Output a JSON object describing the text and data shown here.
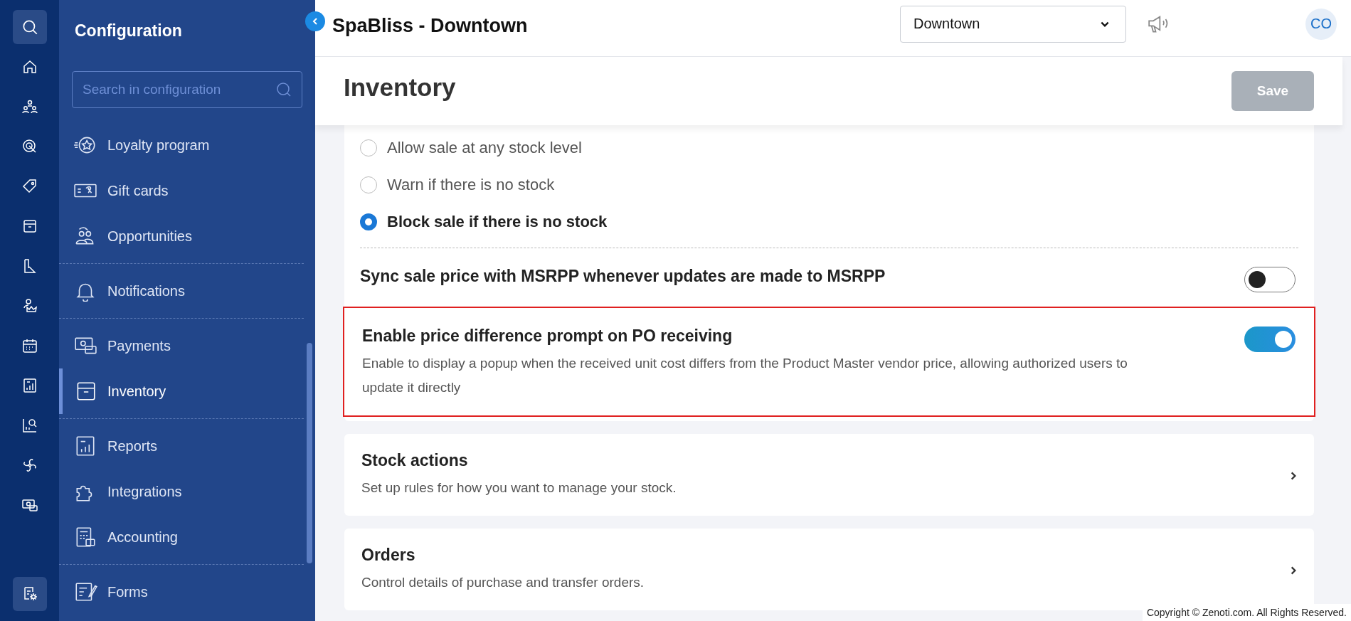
{
  "sidebar": {
    "title": "Configuration",
    "search": {
      "placeholder": "Search in configuration"
    },
    "groups": [
      [
        {
          "label": "Loyalty program",
          "selected": false
        },
        {
          "label": "Gift cards",
          "selected": false
        },
        {
          "label": "Opportunities",
          "selected": false
        }
      ],
      [
        {
          "label": "Notifications",
          "selected": false
        }
      ],
      [
        {
          "label": "Payments",
          "selected": false
        },
        {
          "label": "Inventory",
          "selected": true
        }
      ],
      [
        {
          "label": "Reports",
          "selected": false
        },
        {
          "label": "Integrations",
          "selected": false
        },
        {
          "label": "Accounting",
          "selected": false
        }
      ],
      [
        {
          "label": "Forms",
          "selected": false
        }
      ]
    ]
  },
  "header": {
    "title": "SpaBliss - Downtown",
    "location": "Downtown",
    "avatar": "CO"
  },
  "page": {
    "title": "Inventory",
    "save": {
      "label": "Save",
      "disabled": true
    }
  },
  "stock_options": [
    {
      "label": "Allow sale at any stock level",
      "selected": false
    },
    {
      "label": "Warn if there is no stock",
      "selected": false
    },
    {
      "label": "Block sale if there is no stock",
      "selected": true
    }
  ],
  "settings": [
    {
      "title": "Sync sale price with MSRPP whenever updates are made to MSRPP",
      "on": false,
      "highlighted": false
    },
    {
      "title": "Enable price difference prompt on PO receiving",
      "description": "Enable to display a popup when the received unit cost differs from the Product Master vendor price, allowing authorized users to update it directly",
      "on": true,
      "highlighted": true
    }
  ],
  "sections": [
    {
      "title": "Stock actions",
      "description": "Set up rules for how you want to manage your stock."
    },
    {
      "title": "Orders",
      "description": "Control details of purchase and transfer orders."
    }
  ],
  "footer": "Copyright © Zenoti.com. All Rights Reserved."
}
